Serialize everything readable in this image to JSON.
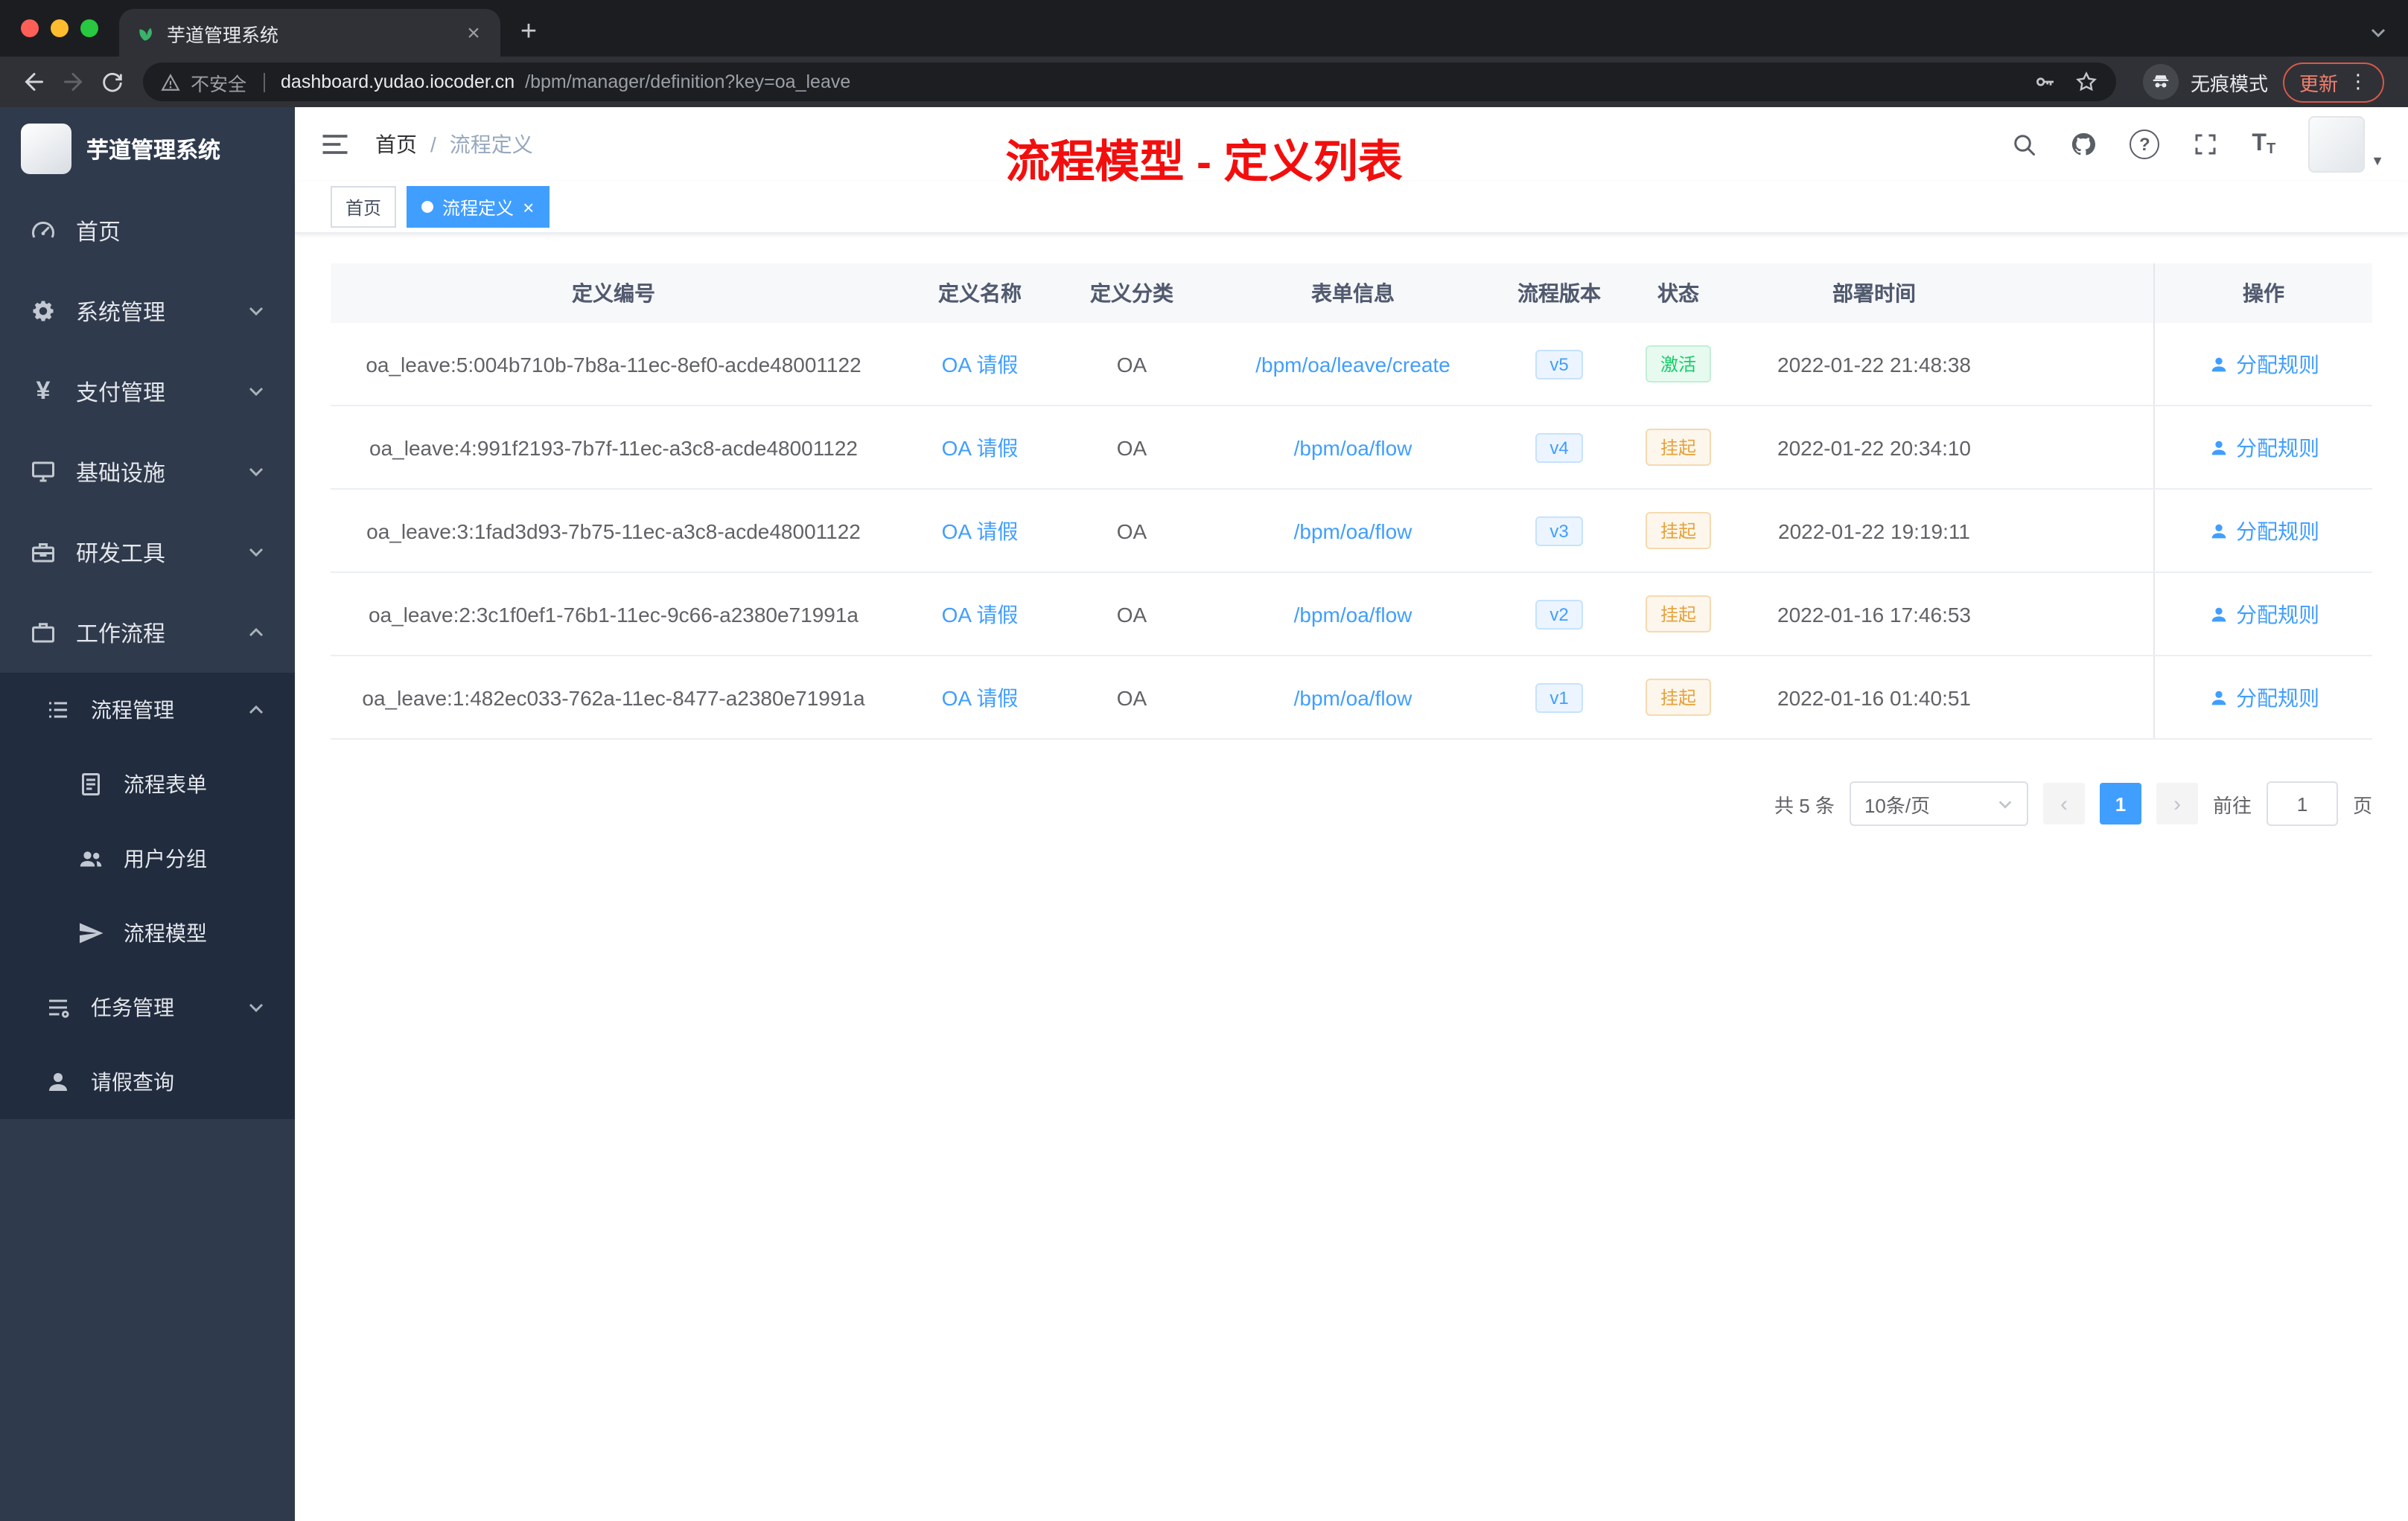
{
  "browser": {
    "tab_title": "芋道管理系统",
    "security_label": "不安全",
    "url_domain": "dashboard.yudao.iocoder.cn",
    "url_path": "/bpm/manager/definition?key=oa_leave",
    "incognito_label": "无痕模式",
    "update_label": "更新"
  },
  "icons": {
    "new_tab": "+",
    "tab_close": "×",
    "menu_dots": "⋮",
    "breadcrumb_sep": "/",
    "tag_close": "×",
    "prev": "‹",
    "next": "›",
    "avatar_caret": "▼"
  },
  "sidebar": {
    "logo_title": "芋道管理系统",
    "items": [
      {
        "label": "首页"
      },
      {
        "label": "系统管理"
      },
      {
        "label": "支付管理"
      },
      {
        "label": "基础设施"
      },
      {
        "label": "研发工具"
      },
      {
        "label": "工作流程"
      }
    ],
    "workflow_submenu": {
      "process_management": {
        "label": "流程管理",
        "items": [
          {
            "label": "流程表单"
          },
          {
            "label": "用户分组"
          },
          {
            "label": "流程模型"
          }
        ]
      },
      "task_management": {
        "label": "任务管理"
      },
      "leave_query": {
        "label": "请假查询"
      }
    }
  },
  "navbar": {
    "breadcrumb": [
      {
        "label": "首页"
      },
      {
        "label": "流程定义"
      }
    ],
    "overlay_title": "流程模型 - 定义列表"
  },
  "tags": [
    {
      "label": "首页",
      "active": false
    },
    {
      "label": "流程定义",
      "active": true
    }
  ],
  "table": {
    "headers": [
      "定义编号",
      "定义名称",
      "定义分类",
      "表单信息",
      "流程版本",
      "状态",
      "部署时间",
      "操作"
    ],
    "rows": [
      {
        "id": "oa_leave:5:004b710b-7b8a-11ec-8ef0-acde48001122",
        "name": "OA 请假",
        "category": "OA",
        "form": "/bpm/oa/leave/create",
        "version": "v5",
        "status": "激活",
        "status_type": "success",
        "time": "2022-01-22 21:48:38",
        "action": "分配规则"
      },
      {
        "id": "oa_leave:4:991f2193-7b7f-11ec-a3c8-acde48001122",
        "name": "OA 请假",
        "category": "OA",
        "form": "/bpm/oa/flow",
        "version": "v4",
        "status": "挂起",
        "status_type": "warning",
        "time": "2022-01-22 20:34:10",
        "action": "分配规则"
      },
      {
        "id": "oa_leave:3:1fad3d93-7b75-11ec-a3c8-acde48001122",
        "name": "OA 请假",
        "category": "OA",
        "form": "/bpm/oa/flow",
        "version": "v3",
        "status": "挂起",
        "status_type": "warning",
        "time": "2022-01-22 19:19:11",
        "action": "分配规则"
      },
      {
        "id": "oa_leave:2:3c1f0ef1-76b1-11ec-9c66-a2380e71991a",
        "name": "OA 请假",
        "category": "OA",
        "form": "/bpm/oa/flow",
        "version": "v2",
        "status": "挂起",
        "status_type": "warning",
        "time": "2022-01-16 17:46:53",
        "action": "分配规则"
      },
      {
        "id": "oa_leave:1:482ec033-762a-11ec-8477-a2380e71991a",
        "name": "OA 请假",
        "category": "OA",
        "form": "/bpm/oa/flow",
        "version": "v1",
        "status": "挂起",
        "status_type": "warning",
        "time": "2022-01-16 01:40:51",
        "action": "分配规则"
      }
    ]
  },
  "pagination": {
    "total_label": "共 5 条",
    "page_size_label": "10条/页",
    "current_page": "1",
    "goto_label": "前往",
    "goto_value": "1",
    "unit_label": "页"
  },
  "theme": {
    "accent": "#409eff",
    "overlay_title_red": "#f30e0e",
    "status_success": "#13ce66",
    "status_warning": "#e6a23c",
    "sidebar_bg": "#2f3a4c",
    "submenu_bg": "#212c3e"
  }
}
